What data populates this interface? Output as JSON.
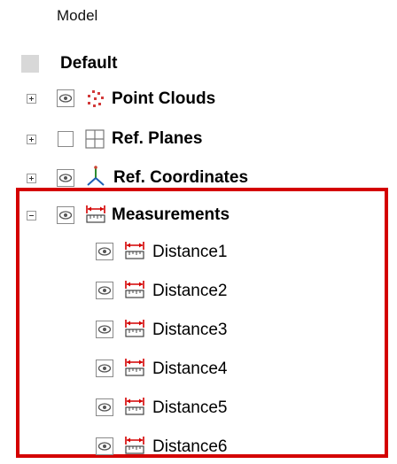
{
  "panel": {
    "header": "Model",
    "default_label": "Default"
  },
  "tree": {
    "point_clouds": {
      "label": "Point Clouds",
      "icon": "point-cloud-icon",
      "expanded": false,
      "visible": true
    },
    "ref_planes": {
      "label": "Ref. Planes",
      "icon": "plane-grid-icon",
      "expanded": false,
      "visible": false
    },
    "ref_coordinates": {
      "label": "Ref. Coordinates",
      "icon": "coordinate-axes-icon",
      "expanded": false,
      "visible": true
    },
    "measurements": {
      "label": "Measurements",
      "icon": "ruler-measure-icon",
      "expanded": true,
      "visible": true,
      "children": [
        {
          "label": "Distance1"
        },
        {
          "label": "Distance2"
        },
        {
          "label": "Distance3"
        },
        {
          "label": "Distance4"
        },
        {
          "label": "Distance5"
        },
        {
          "label": "Distance6"
        }
      ]
    }
  },
  "colors": {
    "highlight_border": "#d40000",
    "point_cloud": "#d23a3a",
    "measure_arrow": "#d40000"
  }
}
